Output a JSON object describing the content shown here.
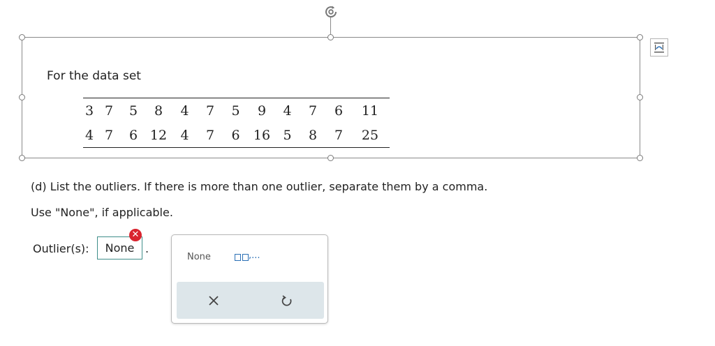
{
  "dataset": {
    "label": "For the data set",
    "row1": [
      "3",
      "7",
      "5",
      "8",
      "4",
      "7",
      "5",
      "9",
      "4",
      "7",
      "6",
      "11"
    ],
    "row2": [
      "4",
      "7",
      "6",
      "12",
      "4",
      "7",
      "6",
      "16",
      "5",
      "8",
      "7",
      "25"
    ]
  },
  "question": {
    "line1": "(d) List the outliers. If there is more than one outlier, separate them by a comma.",
    "line2": "Use \"None\", if applicable."
  },
  "answer": {
    "label": "Outlier(s):",
    "value": "None",
    "period": ".",
    "error_glyph": "✕"
  },
  "palette": {
    "none_label": "None",
    "list_suffix": ",..."
  },
  "colors": {
    "accent": "#3f8e8a",
    "error": "#d9232e",
    "template": "#2a6fb5"
  }
}
